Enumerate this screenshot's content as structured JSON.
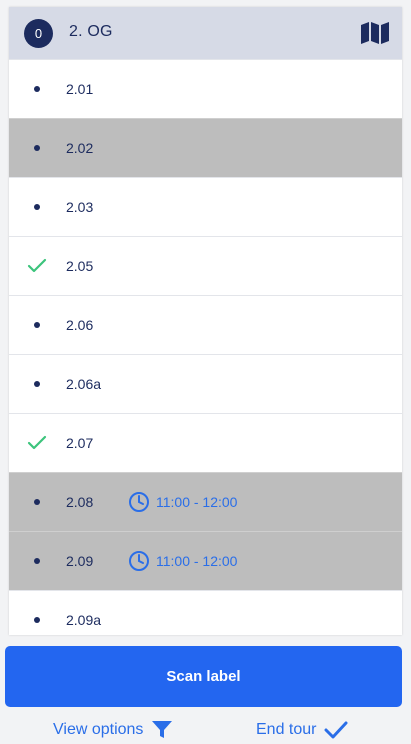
{
  "header": {
    "count": "0",
    "title": "2. OG",
    "icon": "map-icon"
  },
  "rows": [
    {
      "label": "2.01",
      "status": "pending",
      "highlighted": false
    },
    {
      "label": "2.02",
      "status": "pending",
      "highlighted": true
    },
    {
      "label": "2.03",
      "status": "pending",
      "highlighted": false
    },
    {
      "label": "2.05",
      "status": "done",
      "highlighted": false
    },
    {
      "label": "2.06",
      "status": "pending",
      "highlighted": false
    },
    {
      "label": "2.06a",
      "status": "pending",
      "highlighted": false
    },
    {
      "label": "2.07",
      "status": "done",
      "highlighted": false
    },
    {
      "label": "2.08",
      "status": "pending",
      "highlighted": true,
      "time": "11:00 - 12:00"
    },
    {
      "label": "2.09",
      "status": "pending",
      "highlighted": true,
      "time": "11:00 - 12:00"
    },
    {
      "label": "2.09a",
      "status": "pending",
      "highlighted": false
    }
  ],
  "actions": {
    "scan_label": "Scan label",
    "view_options": "View options",
    "end_tour": "End tour"
  },
  "colors": {
    "accent": "#2366f0",
    "navy": "#1c2b5e",
    "check": "#3cc47c",
    "highlight_row": "#bdbdbd",
    "header_bg": "#d6dae6"
  }
}
